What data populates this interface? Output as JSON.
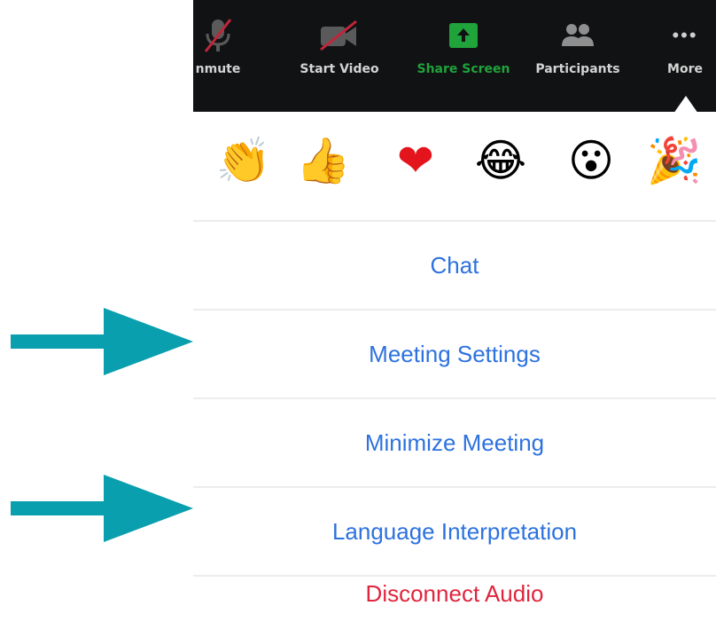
{
  "toolbar": {
    "unmute_label": "nmute",
    "start_video_label": "Start Video",
    "share_screen_label": "Share Screen",
    "participants_label": "Participants",
    "more_label": "More",
    "more_dots": "•••",
    "accent_green": "#1fa33a",
    "background": "#111214"
  },
  "reactions": {
    "items": [
      {
        "icon": "clapping-hands-icon",
        "glyph": "👏"
      },
      {
        "icon": "thumbs-up-icon",
        "glyph": "👍"
      },
      {
        "icon": "heart-icon",
        "glyph": "❤"
      },
      {
        "icon": "tears-of-joy-icon",
        "glyph": "😂"
      },
      {
        "icon": "open-mouth-icon",
        "glyph": "😮"
      },
      {
        "icon": "party-popper-icon",
        "glyph": "🎉"
      }
    ]
  },
  "menu": {
    "chat": "Chat",
    "meeting_settings": "Meeting Settings",
    "minimize_meeting": "Minimize Meeting",
    "language_interpretation": "Language Interpretation",
    "disconnect_audio": "Disconnect Audio",
    "link_color": "#2d72de",
    "danger_color": "#e0253d"
  },
  "annotations": {
    "arrow_color": "#0a9fae"
  }
}
